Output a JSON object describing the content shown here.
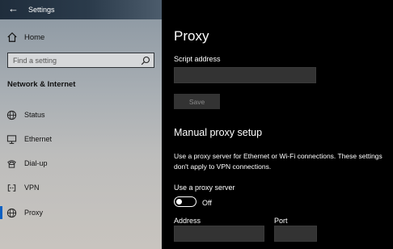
{
  "window": {
    "title": "Settings"
  },
  "sidebar": {
    "home_label": "Home",
    "search_placeholder": "Find a setting",
    "section_title": "Network & Internet",
    "items": [
      {
        "label": "Status",
        "icon": "globe-icon"
      },
      {
        "label": "Ethernet",
        "icon": "monitor-icon"
      },
      {
        "label": "Dial-up",
        "icon": "phone-icon"
      },
      {
        "label": "VPN",
        "icon": "vpn-icon"
      },
      {
        "label": "Proxy",
        "icon": "globe-icon",
        "active": true
      }
    ]
  },
  "main": {
    "page_title": "Proxy",
    "script_address_label": "Script address",
    "script_address_value": "",
    "save_label": "Save",
    "manual_title": "Manual proxy setup",
    "description": "Use a proxy server for Ethernet or Wi-Fi connections. These settings don't apply to VPN connections.",
    "use_proxy_label": "Use a proxy server",
    "toggle_state": "Off",
    "address_label": "Address",
    "address_value": "",
    "port_label": "Port",
    "port_value": ""
  },
  "colors": {
    "accent": "#0a5fc2",
    "field_bg": "#333333"
  }
}
